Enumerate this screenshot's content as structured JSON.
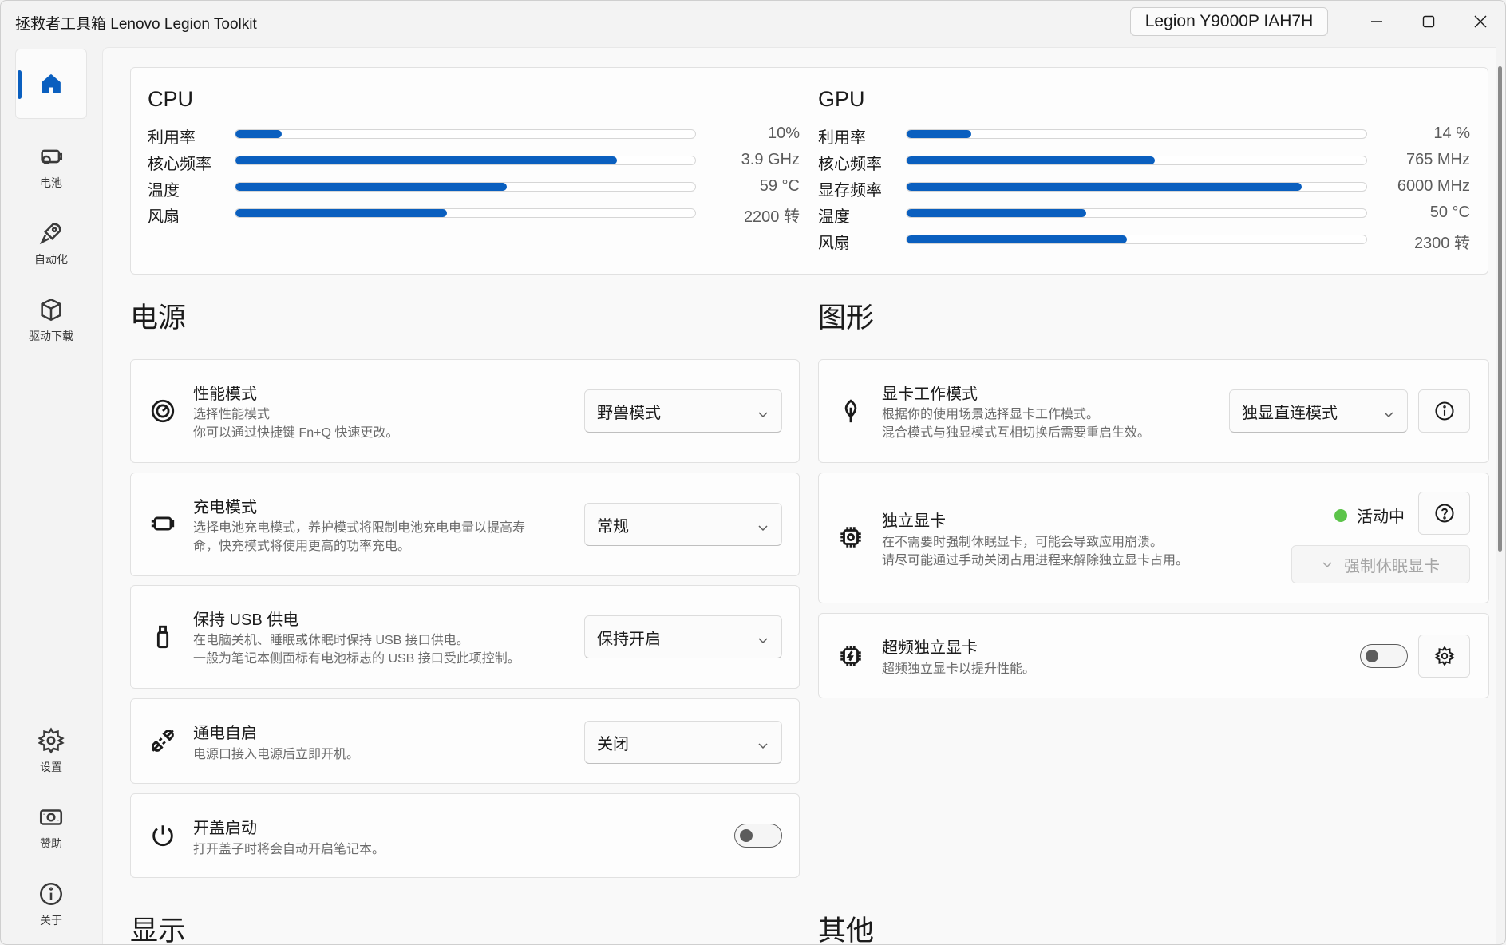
{
  "app": {
    "title": "拯救者工具箱 Lenovo Legion Toolkit",
    "device": "Legion Y9000P IAH7H"
  },
  "sidebar": {
    "items": [
      {
        "label": "",
        "icon": "home-icon"
      },
      {
        "label": "电池",
        "icon": "battery-icon"
      },
      {
        "label": "自动化",
        "icon": "rocket-icon"
      },
      {
        "label": "驱动下载",
        "icon": "package-icon"
      },
      {
        "label": "设置",
        "icon": "gear-icon"
      },
      {
        "label": "赞助",
        "icon": "money-icon"
      },
      {
        "label": "关于",
        "icon": "info-icon"
      }
    ]
  },
  "cpu": {
    "title": "CPU",
    "stats": [
      {
        "label": "利用率",
        "value": "10%",
        "fraction": 0.1
      },
      {
        "label": "核心频率",
        "value": "3.9 GHz",
        "fraction": 0.83
      },
      {
        "label": "温度",
        "value": "59 °C",
        "fraction": 0.59
      },
      {
        "label": "风扇",
        "value": "2200 转",
        "fraction": 0.46
      }
    ]
  },
  "gpu": {
    "title": "GPU",
    "stats": [
      {
        "label": "利用率",
        "value": "14 %",
        "fraction": 0.14
      },
      {
        "label": "核心频率",
        "value": "765 MHz",
        "fraction": 0.54
      },
      {
        "label": "显存频率",
        "value": "6000 MHz",
        "fraction": 0.86
      },
      {
        "label": "温度",
        "value": "50 °C",
        "fraction": 0.39
      },
      {
        "label": "风扇",
        "value": "2300 转",
        "fraction": 0.48
      }
    ]
  },
  "power": {
    "title": "电源",
    "rows": [
      {
        "title": "性能模式",
        "desc1": "选择性能模式",
        "desc2": "你可以通过快捷键 Fn+Q 快速更改。",
        "value": "野兽模式",
        "icon": "gauge-icon"
      },
      {
        "title": "充电模式",
        "desc1": "选择电池充电模式，养护模式将限制电池充电电量以提高寿",
        "desc2": "命，快充模式将使用更高的功率充电。",
        "value": "常规",
        "icon": "charging-icon"
      },
      {
        "title": "保持 USB 供电",
        "desc1": "在电脑关机、睡眠或休眠时保持 USB 接口供电。",
        "desc2": "一般为笔记本侧面标有电池标志的 USB 接口受此项控制。",
        "value": "保持开启",
        "icon": "usb-icon"
      },
      {
        "title": "通电自启",
        "desc1": "电源口接入电源后立即开机。",
        "desc2": "",
        "value": "关闭",
        "icon": "plug-icon"
      },
      {
        "title": "开盖启动",
        "desc1": "打开盖子时将会自动开启笔记本。",
        "desc2": "",
        "toggle": false,
        "icon": "power-icon"
      }
    ]
  },
  "graphics": {
    "title": "图形",
    "mode": {
      "title": "显卡工作模式",
      "desc1": "根据你的使用场景选择显卡工作模式。",
      "desc2": "混合模式与独显模式互相切换后需要重启生效。",
      "value": "独显直连模式",
      "icon": "leaf-icon"
    },
    "dgpu": {
      "title": "独立显卡",
      "desc1": "在不需要时强制休眠显卡，可能会导致应用崩溃。",
      "desc2": "请尽可能通过手动关闭占用进程来解除独立显卡占用。",
      "status": "活动中",
      "status_color": "#5cc44a",
      "button": "强制休眠显卡",
      "icon": "chip-icon"
    },
    "overclock": {
      "title": "超频独立显卡",
      "desc1": "超频独立显卡以提升性能。",
      "toggle": false,
      "icon": "chip-bolt-icon"
    }
  },
  "sections_below": {
    "display": "显示",
    "other": "其他"
  },
  "colors": {
    "accent": "#0a5fbf",
    "active": "#5cc44a"
  }
}
